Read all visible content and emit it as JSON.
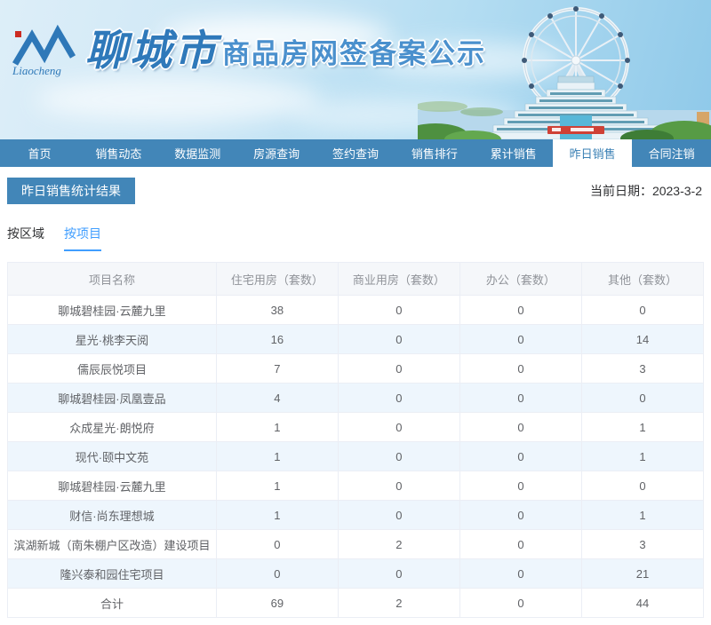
{
  "header": {
    "logo_text": "Liaocheng",
    "city_name": "聊城市",
    "banner_title": "商品房网签备案公示"
  },
  "nav": {
    "items": [
      {
        "label": "首页",
        "active": false
      },
      {
        "label": "销售动态",
        "active": false
      },
      {
        "label": "数据监测",
        "active": false
      },
      {
        "label": "房源查询",
        "active": false
      },
      {
        "label": "签约查询",
        "active": false
      },
      {
        "label": "销售排行",
        "active": false
      },
      {
        "label": "累计销售",
        "active": false
      },
      {
        "label": "昨日销售",
        "active": true
      },
      {
        "label": "合同注销",
        "active": false
      }
    ]
  },
  "content": {
    "section_title": "昨日销售统计结果",
    "date_label": "当前日期：",
    "date_value": "2023-3-2",
    "tabs": [
      {
        "label": "按区域",
        "active": false
      },
      {
        "label": "按项目",
        "active": true
      }
    ]
  },
  "table": {
    "columns": [
      "项目名称",
      "住宅用房（套数）",
      "商业用房（套数）",
      "办公（套数）",
      "其他（套数）"
    ],
    "rows": [
      [
        "聊城碧桂园·云麓九里",
        "38",
        "0",
        "0",
        "0"
      ],
      [
        "星光·桃李天阅",
        "16",
        "0",
        "0",
        "14"
      ],
      [
        "儒辰辰悦项目",
        "7",
        "0",
        "0",
        "3"
      ],
      [
        "聊城碧桂园·凤凰壹品",
        "4",
        "0",
        "0",
        "0"
      ],
      [
        "众成星光·朗悦府",
        "1",
        "0",
        "0",
        "1"
      ],
      [
        "现代·颐中文苑",
        "1",
        "0",
        "0",
        "1"
      ],
      [
        "聊城碧桂园·云麓九里",
        "1",
        "0",
        "0",
        "0"
      ],
      [
        "财信·尚东理想城",
        "1",
        "0",
        "0",
        "1"
      ],
      [
        "滨湖新城（南朱棚户区改造）建设项目",
        "0",
        "2",
        "0",
        "3"
      ],
      [
        "隆兴泰和园住宅项目",
        "0",
        "0",
        "0",
        "21"
      ],
      [
        "合计",
        "69",
        "2",
        "0",
        "44"
      ]
    ]
  },
  "colors": {
    "nav_blue": "#4286b8",
    "active_tab_blue": "#409eff",
    "stripe_row": "#eef6fd",
    "table_border": "#ebeef5",
    "header_bg": "#f5f7fa",
    "header_text": "#909399",
    "cell_text": "#606266",
    "brand_blue": "#2f79ba"
  }
}
